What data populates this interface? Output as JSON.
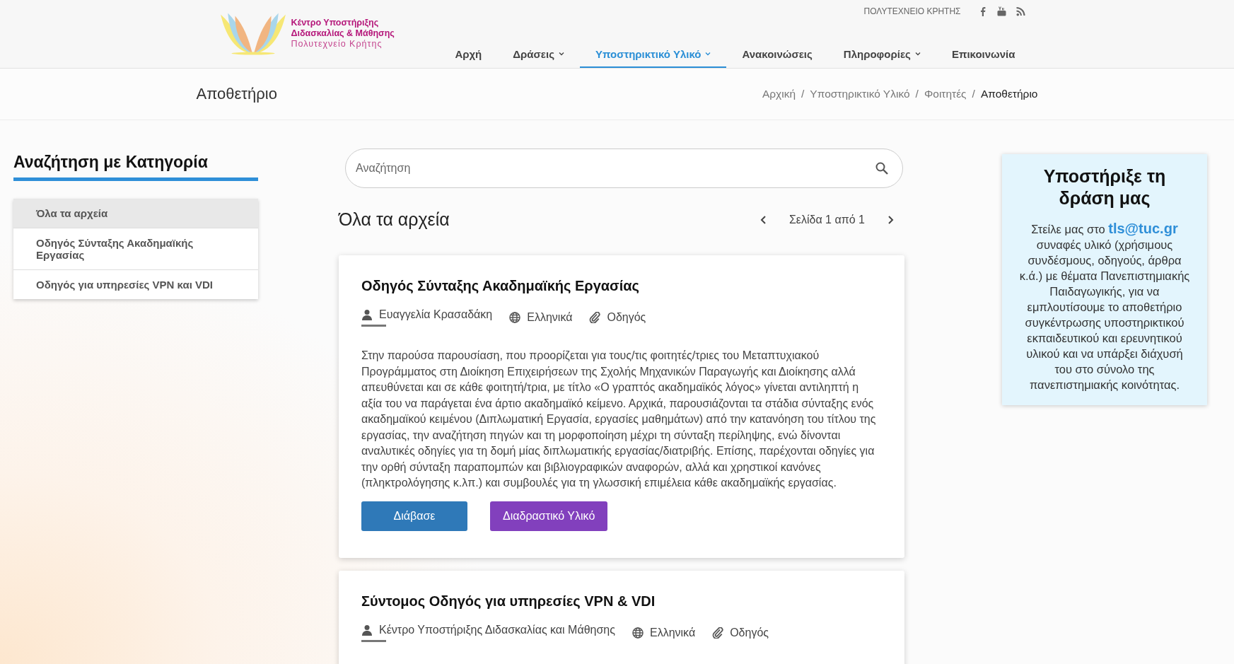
{
  "header": {
    "logo": {
      "lines": [
        "Κέντρο Υποστήριξης",
        "Διδασκαλίας & Μάθησης",
        "Πολυτεχνείο Κρήτης"
      ]
    },
    "top_link": "ΠΟΛΥΤΕΧΝΕΙΟ ΚΡΗΤΗΣ",
    "social": [
      {
        "kind": "facebook"
      },
      {
        "kind": "youtube"
      },
      {
        "kind": "rss"
      }
    ],
    "nav": [
      {
        "label": "Αρχή",
        "dropdown": false,
        "selected": false
      },
      {
        "label": "Δράσεις",
        "dropdown": true,
        "selected": false
      },
      {
        "label": "Υποστηρικτικό Υλικό",
        "dropdown": true,
        "selected": true
      },
      {
        "label": "Ανακοινώσεις",
        "dropdown": false,
        "selected": false
      },
      {
        "label": "Πληροφορίες",
        "dropdown": true,
        "selected": false
      },
      {
        "label": "Επικοινωνία",
        "dropdown": false,
        "selected": false
      }
    ]
  },
  "page_title": "Αποθετήριο",
  "breadcrumb": [
    {
      "label": "Αρχική",
      "current": false
    },
    {
      "separator": "/",
      "label": "Υποστηρικτικό Υλικό",
      "current": false
    },
    {
      "separator": "/",
      "label": "Φοιτητές",
      "current": false
    },
    {
      "separator": "/",
      "label": "Αποθετήριο",
      "current": true
    }
  ],
  "sidebar": {
    "title": "Αναζήτηση με Κατηγορία",
    "items": [
      {
        "label": "Όλα τα αρχεία",
        "selected": true
      },
      {
        "label": "Οδηγός Σύνταξης Ακαδημαϊκής Εργασίας",
        "selected": false
      },
      {
        "label": "Οδηγός για υπηρεσίες VPN και VDI",
        "selected": false
      }
    ]
  },
  "search": {
    "placeholder": "Αναζήτηση"
  },
  "list_title": "Όλα τα αρχεία",
  "pagination": "Σελίδα 1 από 1",
  "cards": [
    {
      "title": "Οδηγός Σύνταξης Ακαδημαϊκής Εργασίας",
      "author": "Ευαγγελία Κρασαδάκη",
      "language": "Ελληνικά",
      "type": "Οδηγός",
      "description": "Στην παρούσα παρουσίαση, που προορίζεται για τους/τις φοιτητές/τριες του Μεταπτυχιακού Προγράμματος στη Διοίκηση Επιχειρήσεων της Σχολής Μηχανικών Παραγωγής και Διοίκησης αλλά απευθύνεται και σε κάθε φοιτητή/τρια, με τίτλο «Ο γραπτός ακαδημαϊκός λόγος» γίνεται αντιληπτή η αξία του να παράγεται ένα άρτιο ακαδημαϊκό κείμενο. Αρχικά, παρουσιάζονται τα στάδια σύνταξης ενός ακαδημαϊκού κειμένου (Διπλωματική Εργασία, εργασίες μαθημάτων) από την κατανόηση του τίτλου της εργασίας, την αναζήτηση πηγών και τη μορφοποίηση μέχρι τη σύνταξη περίληψης, ενώ δίνονται αναλυτικές οδηγίες για τη δομή μίας διπλωματικής εργασίας/διατριβής. Επίσης, παρέχονται οδηγίες για την ορθή σύνταξη παραπομπών και βιβλιογραφικών αναφορών, αλλά και χρηστικοί κανόνες (πληκτρολόγησης κ.λπ.) και συμβουλές για τη γλωσσική επιμέλεια κάθε ακαδημαϊκής εργασίας.",
      "buttons": [
        {
          "label": "Διάβασε",
          "kind": "read"
        },
        {
          "label": "Διαδραστικό Υλικό",
          "kind": "interactive"
        }
      ]
    },
    {
      "title": "Σύντομος Οδηγός για υπηρεσίες VPN & VDI",
      "author": "Κέντρο Υποστήριξης Διδασκαλίας και Μάθησης",
      "language": "Ελληνικά",
      "type": "Οδηγός"
    }
  ],
  "support": {
    "title": "Υποστήριξε τη δράση μας",
    "text_before": "Στείλε μας στο",
    "email": "tls@tuc.gr",
    "text_after": "συναφές υλικό (χρήσιμους συνδέσμους, οδηγούς, άρθρα κ.ά.) με θέματα Πανεπιστημιακής Παιδαγωγικής, για να εμπλουτίσουμε το αποθετήριο συγκέντρωσης υποστηρικτικού εκπαιδευτικού και ερευνητικού υλικού και να υπάρξει διάχυσή του στο σύνολο της πανεπιστημιακής κοινότητας."
  }
}
